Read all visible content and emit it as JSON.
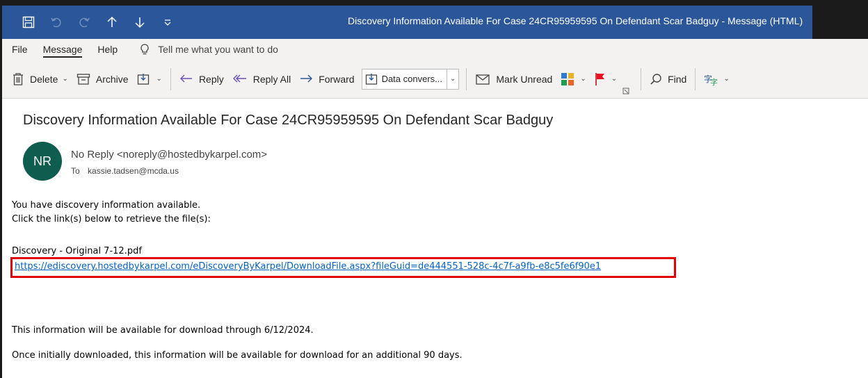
{
  "window": {
    "title": "Discovery Information Available For Case 24CR95959595 On Defendant Scar Badguy  -  Message (HTML)"
  },
  "quick_access": {
    "icons": [
      "save-icon",
      "undo-icon",
      "redo-icon",
      "up-arrow-icon",
      "down-arrow-icon",
      "customize-icon"
    ]
  },
  "tabs": {
    "file": "File",
    "message": "Message",
    "help": "Help",
    "tell_me": "Tell me what you want to do"
  },
  "ribbon": {
    "delete": "Delete",
    "archive": "Archive",
    "reply": "Reply",
    "reply_all": "Reply All",
    "forward": "Forward",
    "quick_step": "Data convers...",
    "mark_unread": "Mark Unread",
    "find": "Find"
  },
  "message": {
    "subject": "Discovery Information Available For Case 24CR95959595 On Defendant Scar Badguy",
    "avatar_initials": "NR",
    "sender": "No Reply <noreply@hostedbykarpel.com>",
    "to_label": "To",
    "recipient": "kassie.tadsen@mcda.us",
    "line1": "You have discovery information available.",
    "line2": "Click the link(s) below to retrieve the file(s):",
    "file_name": "Discovery - Original  7-12.pdf",
    "link": "https://ediscovery.hostedbykarpel.com/eDiscoveryByKarpel/DownloadFile.aspx?fileGuid=de444551-528c-4c7f-a9fb-e8c5fe6f90e1",
    "availability": "This information will be available for download through 6/12/2024.",
    "after_download": "Once initially downloaded, this information will be available for download for an additional 90 days."
  },
  "colors": {
    "title_bar": "#2b579a",
    "avatar": "#0f5d4f",
    "link": "#0563c1",
    "highlight": "#e00000"
  }
}
